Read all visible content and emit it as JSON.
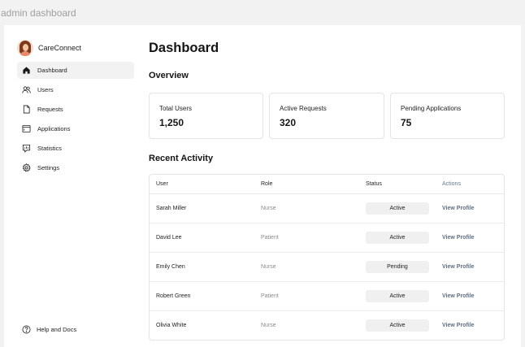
{
  "window": {
    "title": "admin dashboard"
  },
  "sidebar": {
    "brand": "CareConnect",
    "items": [
      {
        "label": "Dashboard",
        "icon": "home-icon",
        "active": true
      },
      {
        "label": "Users",
        "icon": "users-icon"
      },
      {
        "label": "Requests",
        "icon": "document-icon"
      },
      {
        "label": "Applications",
        "icon": "window-icon"
      },
      {
        "label": "Statistics",
        "icon": "chart-icon"
      },
      {
        "label": "Settings",
        "icon": "gear-icon"
      }
    ],
    "help": "Help and Docs"
  },
  "main": {
    "title": "Dashboard",
    "overview_title": "Overview",
    "stats": [
      {
        "label": "Total Users",
        "value": "1,250"
      },
      {
        "label": "Active Requests",
        "value": "320"
      },
      {
        "label": "Pending Applications",
        "value": "75"
      }
    ],
    "recent_title": "Recent Activity",
    "table": {
      "headers": {
        "user": "User",
        "role": "Role",
        "status": "Status",
        "actions": "Actions"
      },
      "rows": [
        {
          "user": "Sarah Miller",
          "role": "Nurse",
          "status": "Active",
          "action": "View Profile"
        },
        {
          "user": "David Lee",
          "role": "Patient",
          "status": "Active",
          "action": "View Profile"
        },
        {
          "user": "Emily Chen",
          "role": "Nurse",
          "status": "Pending",
          "action": "View Profile"
        },
        {
          "user": "Robert Green",
          "role": "Patient",
          "status": "Active",
          "action": "View Profile"
        },
        {
          "user": "Olivia White",
          "role": "Nurse",
          "status": "Active",
          "action": "View Profile"
        }
      ]
    }
  },
  "colors": {
    "accent_link": "#5f6f82",
    "active_nav_bg": "#f2f2f2",
    "badge_bg": "#f0f0f0"
  }
}
